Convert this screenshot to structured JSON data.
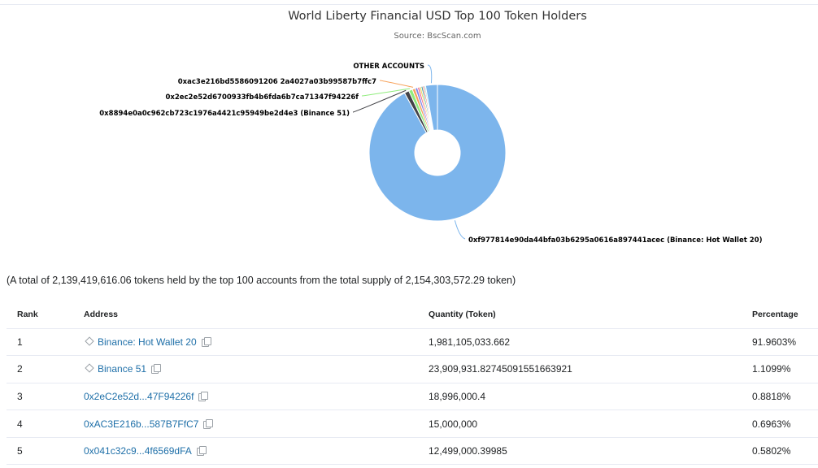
{
  "chart_data": {
    "type": "pie",
    "title": "World Liberty Financial USD Top 100 Token Holders",
    "subtitle": "Source: BscScan.com",
    "slices": [
      {
        "label": "0xf977814e90da44bfa03b6295a0616a897441acec (Binance: Hot Wallet 20)",
        "value": 91.9603,
        "color": "#7cb5ec"
      },
      {
        "label": "0x8894e0a0c962cb723c1976a4421c95949be2d4e3 (Binance 51)",
        "value": 1.1099,
        "color": "#434348"
      },
      {
        "label": "0x2ec2e52d6700933fb4b6fda6b7ca71347f94226f",
        "value": 0.8818,
        "color": "#90ed7d"
      },
      {
        "label": "0xac3e216bd5586091206 2a4027a03b99587b7ffc7",
        "value": 0.6963,
        "color": "#f7a35c"
      },
      {
        "label": "",
        "value": 0.5802,
        "color": "#8085e9"
      },
      {
        "label": "",
        "value": 0.45,
        "color": "#f15c80"
      },
      {
        "label": "",
        "value": 0.42,
        "color": "#e4d354"
      },
      {
        "label": "",
        "value": 0.38,
        "color": "#2b908f"
      },
      {
        "label": "",
        "value": 0.35,
        "color": "#f45b5b"
      },
      {
        "label": "",
        "value": 0.33,
        "color": "#91e8e1"
      },
      {
        "label": "OTHER ACCOUNTS",
        "value": 2.8,
        "color": "#7cb5ec"
      }
    ]
  },
  "summary": {
    "text": "(A total of 2,139,419,616.06 tokens held by the top 100 accounts from the total supply of 2,154,303,572.29 token)"
  },
  "table": {
    "headers": {
      "rank": "Rank",
      "address": "Address",
      "quantity": "Quantity (Token)",
      "percentage": "Percentage"
    },
    "rows": [
      {
        "rank": "1",
        "address": "Binance: Hot Wallet 20",
        "labeled": true,
        "quantity": "1,981,105,033.662",
        "percentage": "91.9603%"
      },
      {
        "rank": "2",
        "address": "Binance 51",
        "labeled": true,
        "quantity": "23,909,931.82745091551663921",
        "percentage": "1.1099%"
      },
      {
        "rank": "3",
        "address": "0x2eC2e52d...47F94226f",
        "labeled": false,
        "quantity": "18,996,000.4",
        "percentage": "0.8818%"
      },
      {
        "rank": "4",
        "address": "0xAC3E216b...587B7FfC7",
        "labeled": false,
        "quantity": "15,000,000",
        "percentage": "0.6963%"
      },
      {
        "rank": "5",
        "address": "0x041c32c9...4f6569dFA",
        "labeled": false,
        "quantity": "12,499,000.39985",
        "percentage": "0.5802%"
      }
    ]
  }
}
